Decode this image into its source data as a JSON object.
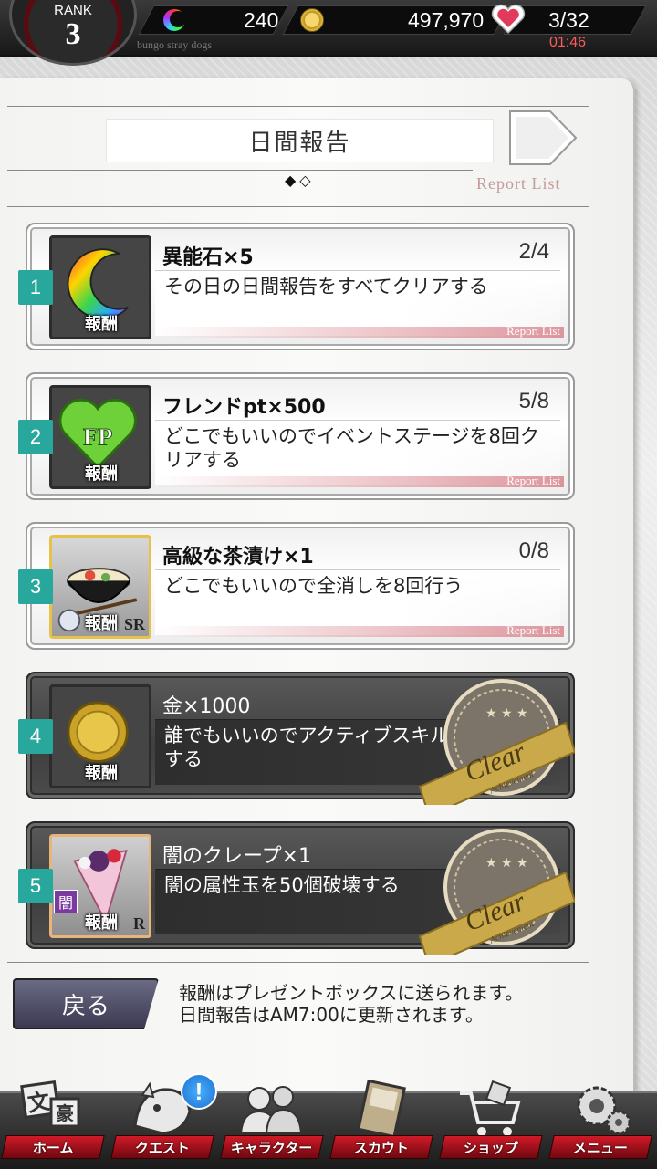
{
  "status": {
    "rank_label": "RANK",
    "rank_value": "3",
    "stones": "240",
    "coins": "497,970",
    "ap": "3/32",
    "ap_timer": "01:46",
    "subtitle": "bungo stray dogs"
  },
  "header": {
    "title": "日間報告",
    "page_dots": "◆◇",
    "report_link": "Report List"
  },
  "missions": [
    {
      "num": "1",
      "reward": "異能石×5",
      "progress": "2/4",
      "desc": "その日の日間報告をすべてクリアする",
      "tag": "報酬",
      "strip": "Report List",
      "state": "incomplete",
      "icon": "ability-stone-icon"
    },
    {
      "num": "2",
      "reward": "フレンドpt×500",
      "progress": "5/8",
      "desc": "どこでもいいのでイベントステージを8回クリアする",
      "tag": "報酬",
      "strip": "Report List",
      "state": "incomplete",
      "icon": "friend-point-icon"
    },
    {
      "num": "3",
      "reward": "高級な茶漬け×1",
      "progress": "0/8",
      "desc": "どこでもいいので全消しを8回行う",
      "tag": "報酬",
      "rarity": "SR",
      "strip": "Report List",
      "state": "incomplete",
      "icon": "ochazuke-icon"
    },
    {
      "num": "4",
      "reward": "金×1000",
      "desc": "誰でもいいのでアクティブスキルを3回発動する",
      "tag": "報酬",
      "state": "clear",
      "icon": "gold-coin-icon"
    },
    {
      "num": "5",
      "reward": "闇のクレープ×1",
      "desc": "闇の属性玉を50個破壊する",
      "tag": "報酬",
      "rarity": "R",
      "badge": "闇",
      "state": "clear",
      "icon": "crepe-icon"
    }
  ],
  "stamp": {
    "text": "Clear",
    "sub": "Achievement"
  },
  "footer": {
    "back": "戻る",
    "notice_1": "報酬はプレゼントボックスに送られます。",
    "notice_2": "日間報告はAM7:00に更新されます。"
  },
  "nav": [
    {
      "label": "ホーム",
      "icon": "home-bundo-icon"
    },
    {
      "label": "クエスト",
      "icon": "quest-dog-icon",
      "alert": "!"
    },
    {
      "label": "キャラクター",
      "icon": "character-silhouette-icon"
    },
    {
      "label": "スカウト",
      "icon": "scout-book-icon"
    },
    {
      "label": "ショップ",
      "icon": "shop-cart-icon"
    },
    {
      "label": "メニュー",
      "icon": "menu-gear-icon"
    }
  ],
  "colors": {
    "accent_teal": "#28a89c",
    "nav_red": "#d01a28",
    "timer_red": "#ff5a5a",
    "link_pink": "#c59a9a"
  }
}
